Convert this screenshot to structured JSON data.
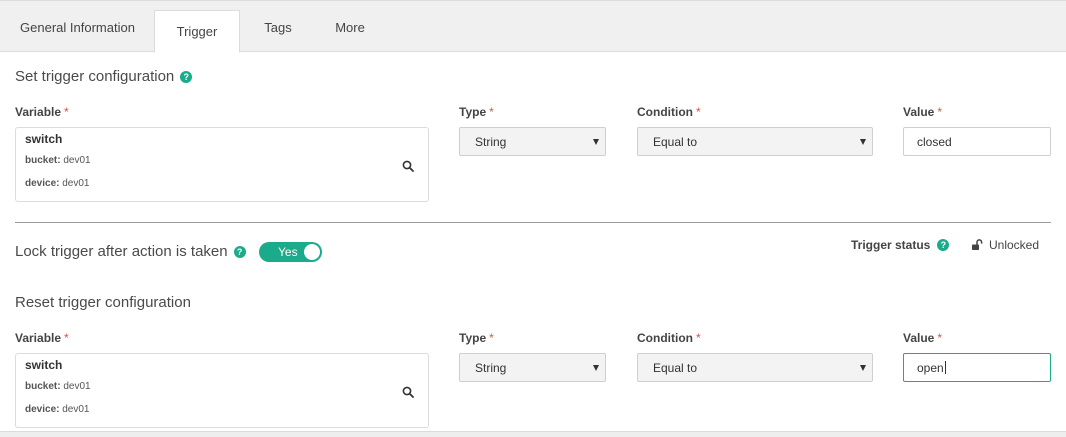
{
  "tabs": [
    {
      "label": "General Information"
    },
    {
      "label": "Trigger"
    },
    {
      "label": "Tags"
    },
    {
      "label": "More"
    }
  ],
  "active_tab": "Trigger",
  "trigger": {
    "title": "Set trigger configuration",
    "variable_label": "Variable",
    "type_label": "Type",
    "condition_label": "Condition",
    "value_label": "Value",
    "required_mark": "*",
    "variable": {
      "name": "switch",
      "bucket_key": "bucket:",
      "bucket_value": "dev01",
      "device_key": "device:",
      "device_value": "dev01"
    },
    "type_value": "String",
    "condition_value": "Equal to",
    "value": "closed"
  },
  "lock": {
    "label": "Lock trigger after action is taken",
    "toggle_label": "Yes",
    "toggle_on": true
  },
  "status": {
    "label": "Trigger status",
    "value": "Unlocked"
  },
  "reset": {
    "title": "Reset trigger configuration",
    "variable_label": "Variable",
    "type_label": "Type",
    "condition_label": "Condition",
    "value_label": "Value",
    "required_mark": "*",
    "variable": {
      "name": "switch",
      "bucket_key": "bucket:",
      "bucket_value": "dev01",
      "device_key": "device:",
      "device_value": "dev01"
    },
    "type_value": "String",
    "condition_value": "Equal to",
    "value": "open"
  },
  "colors": {
    "accent": "#1aab8a",
    "required": "#d9534f"
  },
  "icons": [
    "help-icon",
    "search-icon",
    "chevron-down-icon",
    "unlock-icon"
  ]
}
